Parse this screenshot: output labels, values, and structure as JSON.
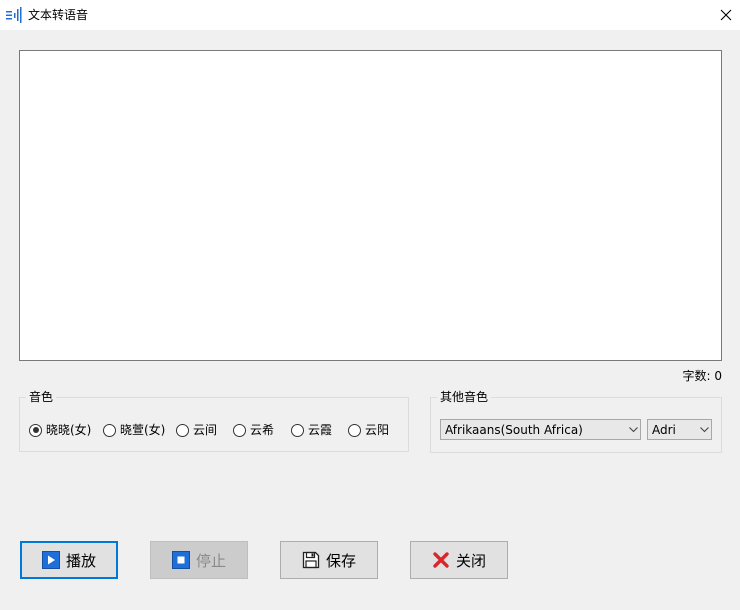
{
  "window": {
    "title": "文本转语音"
  },
  "editor": {
    "value": ""
  },
  "count": {
    "label": "字数: 0"
  },
  "voice_group": {
    "legend": "音色",
    "options": [
      {
        "label": "晓晓(女)",
        "checked": true
      },
      {
        "label": "晓萱(女)",
        "checked": false
      },
      {
        "label": "云间",
        "checked": false
      },
      {
        "label": "云希",
        "checked": false
      },
      {
        "label": "云霞",
        "checked": false
      },
      {
        "label": "云阳",
        "checked": false
      }
    ]
  },
  "other_group": {
    "legend": "其他音色",
    "language_selected": "Afrikaans(South Africa)",
    "voice_selected": "Adri"
  },
  "buttons": {
    "play": "播放",
    "stop": "停止",
    "save": "保存",
    "close": "关闭"
  },
  "colors": {
    "accent": "#0078d7",
    "close_red": "#d9262b"
  }
}
